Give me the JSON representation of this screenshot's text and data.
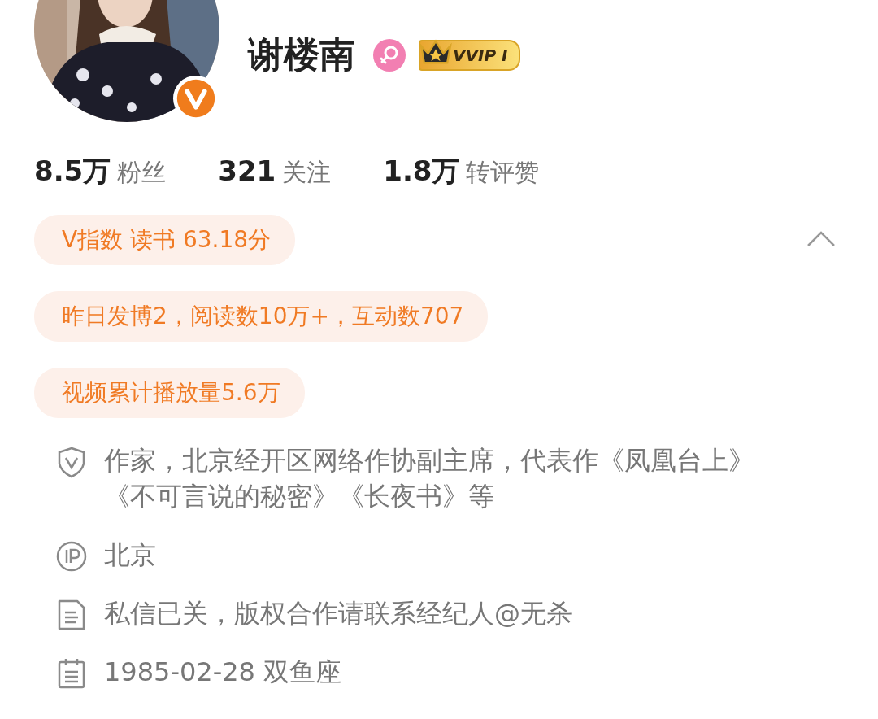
{
  "profile": {
    "name": "谢楼南",
    "verified": true,
    "female": true,
    "vip_label": "VVIP I"
  },
  "stats": [
    {
      "value": "8.5万",
      "label": "粉丝"
    },
    {
      "value": "321",
      "label": "关注"
    },
    {
      "value": "1.8万",
      "label": "转评赞"
    }
  ],
  "highlights": {
    "expanded": true,
    "items": [
      "V指数 读书 63.18分",
      "昨日发博2，阅读数10万+，互动数707",
      "视频累计播放量5.6万"
    ]
  },
  "info": [
    {
      "kind": "verified",
      "text": "作家，北京经开区网络作协副主席，代表作《凤凰台上》《不可言说的秘密》《长夜书》等"
    },
    {
      "kind": "ip",
      "text": "北京"
    },
    {
      "kind": "note",
      "text": "私信已关，版权合作请联系经纪人@无杀"
    },
    {
      "kind": "birthday",
      "text": "1985-02-28 双鱼座"
    }
  ]
}
